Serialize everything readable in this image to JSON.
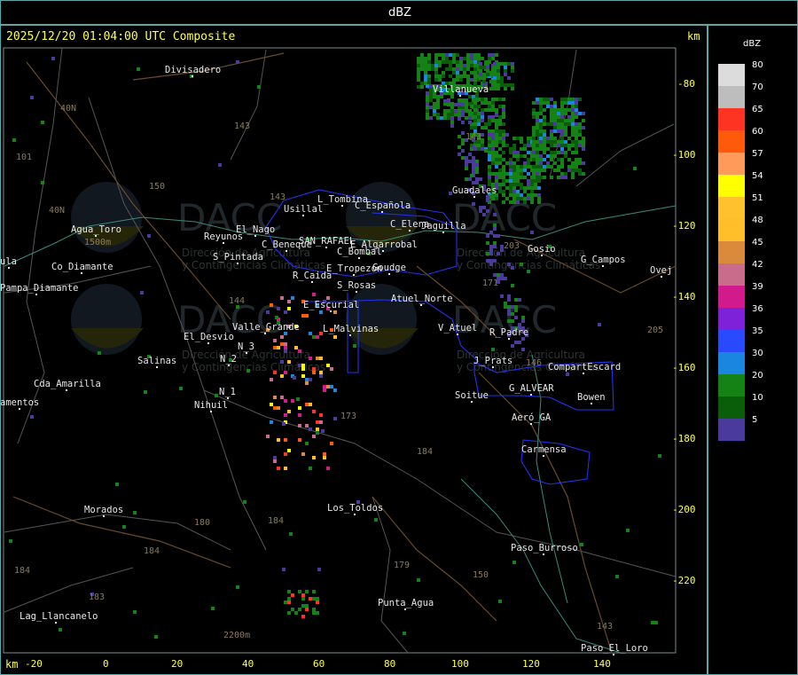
{
  "title": "dBZ",
  "timestamp": "2025/12/20 01:04:00 UTC Composite",
  "km_label": "km",
  "x_ticks": [
    "-20",
    "0",
    "20",
    "40",
    "60",
    "80",
    "100",
    "120",
    "140"
  ],
  "y_ticks": [
    "-80",
    "-100",
    "-120",
    "-140",
    "-160",
    "-180",
    "-200",
    "-220"
  ],
  "legend": {
    "title": "dBZ",
    "entries": [
      {
        "value": "80",
        "color": "#dcdcdc"
      },
      {
        "value": "70",
        "color": "#bdbdbd"
      },
      {
        "value": "65",
        "color": "#ff3322"
      },
      {
        "value": "60",
        "color": "#ff5a0a"
      },
      {
        "value": "57",
        "color": "#ff9a5a"
      },
      {
        "value": "54",
        "color": "#ffff00"
      },
      {
        "value": "51",
        "color": "#ffc22e"
      },
      {
        "value": "48",
        "color": "#ffbf2a"
      },
      {
        "value": "45",
        "color": "#d98a3a"
      },
      {
        "value": "42",
        "color": "#c96b8a"
      },
      {
        "value": "39",
        "color": "#d31a8c"
      },
      {
        "value": "36",
        "color": "#7d22d8"
      },
      {
        "value": "35",
        "color": "#2a4aff"
      },
      {
        "value": "30",
        "color": "#1a86e0"
      },
      {
        "value": "20",
        "color": "#148214"
      },
      {
        "value": "10",
        "color": "#0a5e0a"
      },
      {
        "value": "5",
        "color": "#4a3a9c"
      }
    ]
  },
  "watermark": {
    "brand": "DACC",
    "line1": "Dirección de Agricultura",
    "line2": "y Contingencias Climáticas"
  },
  "places": [
    "Divisadero",
    "Villanueva",
    "Guadales",
    "Gosio",
    "G_Campos",
    "Ovej",
    "Usillal",
    "L_Tombina",
    "C_Española",
    "C_Elena",
    "Jaguilla",
    "Agua_Toro",
    "Reyunos",
    "El_Nago",
    "C_Beneque",
    "SAN_RAFAEL",
    "E_Algarrobal",
    "C_Bombal",
    "S_Pintada",
    "E_Tropezon",
    "Goudge",
    "R_Caida",
    "S_Rosas",
    "Atuel_Norte",
    "E_Escurial",
    "Valle_Grande",
    "L_Malvinas",
    "V_Atuel",
    "R_Padre",
    "El_Desvio",
    "N_3",
    "N_2",
    "Salinas",
    "J_Prats",
    "CompartEscard",
    "G_ALVEAR",
    "Bowen",
    "Soitue",
    "N_1",
    "Nihuil",
    "Cda_Amarilla",
    "amentos",
    "Aeró_GA",
    "Carmensa",
    "Los_Toldos",
    "Morados",
    "Paso_Burroso",
    "Punta_Agua",
    "Lag_Llancanelo",
    "Paso_El_Loro",
    "Pampa_Diamante",
    "Co_Diamante",
    "ula"
  ],
  "routes": [
    "40N",
    "101",
    "40N",
    "143",
    "150",
    "143",
    "144",
    "173",
    "184",
    "180",
    "184",
    "179",
    "183",
    "184",
    "150",
    "171",
    "143",
    "146",
    "203",
    "205",
    "184",
    "143"
  ],
  "elevations": [
    "1500m",
    "2200m"
  ]
}
